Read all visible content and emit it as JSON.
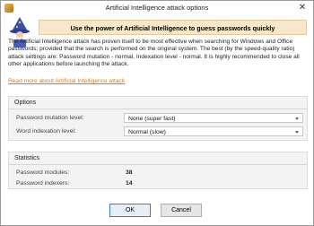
{
  "window": {
    "title": "Artificial Intelligence attack options",
    "close_label": "✕"
  },
  "banner": {
    "text": "Use the power of Artificial Intelligence to guess passwords quickly"
  },
  "description": "The Artificial Intelligence attack has proven itself to be most effective when searching for Windows and Office passwords; provided that the search is performed on the original system. The best (by the speed-quality ratio) attack settings are: Password mutation - normal, Indexation level - normal. It is highly recommended to close all other applications before launching the attack.",
  "link": "Read more about Artificial Intelligence attack",
  "options": {
    "title": "Options",
    "mutation_label": "Password mutation level:",
    "mutation_value": "None (super fast)",
    "indexation_label": "Word indexation level:",
    "indexation_value": "Normal (slow)"
  },
  "statistics": {
    "title": "Statistics",
    "modules_label": "Password modules:",
    "modules_value": "38",
    "indexers_label": "Password indexers:",
    "indexers_value": "14"
  },
  "buttons": {
    "ok": "OK",
    "cancel": "Cancel"
  },
  "icons": {
    "app": "app-icon",
    "wizard": "wizard-icon",
    "close": "close-icon",
    "dropdown": "chevron-down-icon"
  },
  "colors": {
    "banner_bg": "#f8e7c8",
    "link": "#e07a1e"
  }
}
